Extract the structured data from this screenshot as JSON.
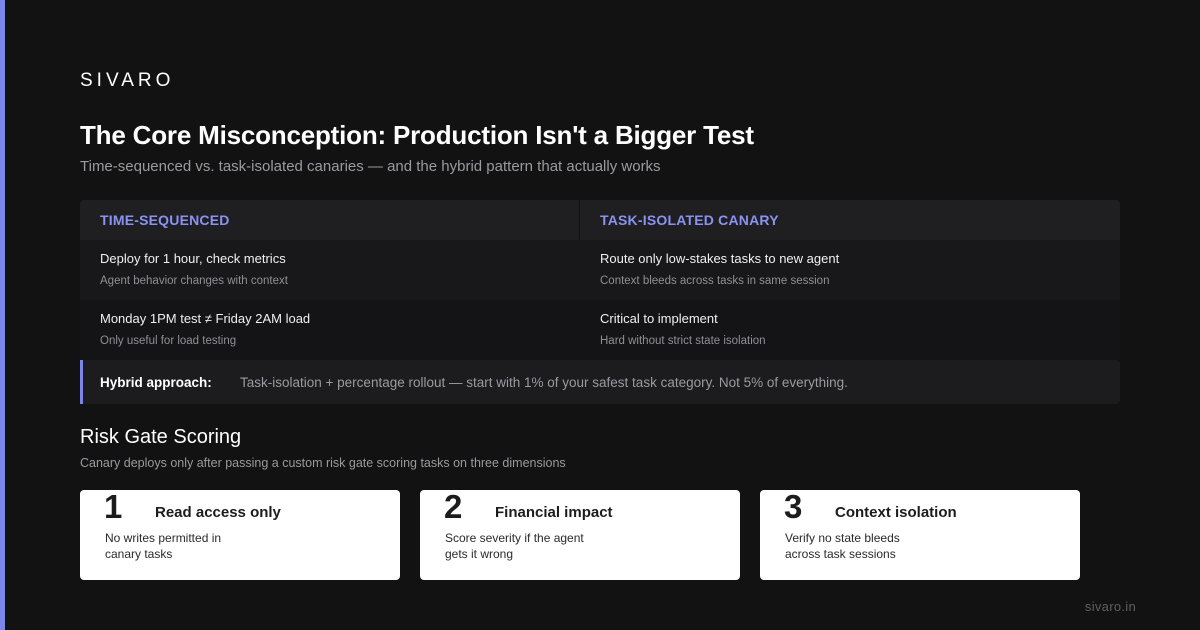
{
  "brand": "SIVARO",
  "title": "The Core Misconception: Production Isn't a Bigger Test",
  "subtitle": "Time-sequenced vs. task-isolated canaries — and the hybrid pattern that actually works",
  "comparison": {
    "headers": [
      "TIME-SEQUENCED",
      "TASK-ISOLATED CANARY"
    ],
    "rows": [
      {
        "left": {
          "main": "Deploy for 1 hour, check metrics",
          "sub": "Agent behavior changes with context"
        },
        "right": {
          "main": "Route only low-stakes tasks to new agent",
          "sub": "Context bleeds across tasks in same session"
        }
      },
      {
        "left": {
          "main": "Monday 1PM test ≠ Friday 2AM load",
          "sub": "Only useful for load testing"
        },
        "right": {
          "main": "Critical to implement",
          "sub": "Hard without strict state isolation"
        }
      }
    ]
  },
  "hybrid": {
    "label": "Hybrid approach:",
    "text": "Task-isolation + percentage rollout — start with 1% of your safest task category. Not 5% of everything."
  },
  "risk": {
    "title": "Risk Gate Scoring",
    "subtitle": "Canary deploys only after passing a custom risk gate scoring tasks on three dimensions",
    "cards": [
      {
        "number": "1",
        "title": "Read access only",
        "desc": "No writes permitted in canary tasks"
      },
      {
        "number": "2",
        "title": "Financial impact",
        "desc": "Score severity if the agent gets it wrong"
      },
      {
        "number": "3",
        "title": "Context isolation",
        "desc": "Verify no state bleeds across task sessions"
      }
    ]
  },
  "footer": "sivaro.in",
  "colors": {
    "background": "#121212",
    "accent": "#7b86e8",
    "header_text": "#8a93f0",
    "card": "#ffffff"
  }
}
